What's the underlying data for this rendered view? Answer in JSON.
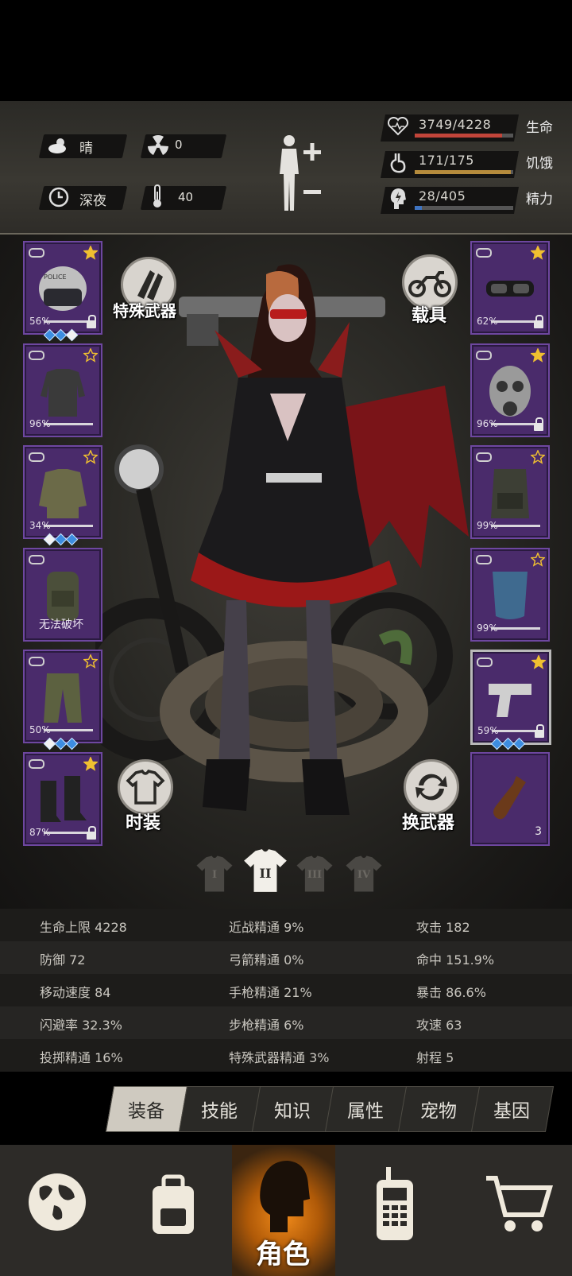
{
  "status": {
    "weather": "晴",
    "radiation": "0",
    "time_of_day": "深夜",
    "temperature": "40"
  },
  "vitals": [
    {
      "value": "3749/4228",
      "label": "生命",
      "fraction": 0.887,
      "color": "#c2453a"
    },
    {
      "value": "171/175",
      "label": "饥饿",
      "fraction": 0.977,
      "color": "#b58b3c"
    },
    {
      "value": "28/405",
      "label": "精力",
      "fraction": 0.069,
      "color": "#3f74c0"
    }
  ],
  "scene_buttons": {
    "special_weapon": "特殊武器",
    "vehicle": "载具",
    "fashion": "时装",
    "swap_weapon": "换武器"
  },
  "left_slots": [
    {
      "name": "helmet",
      "pct": "56%",
      "star": "filled",
      "locked": true,
      "gems": [
        "blue",
        "blue",
        "white"
      ]
    },
    {
      "name": "shirt",
      "pct": "96%",
      "star": "outline",
      "locked": false,
      "gems": []
    },
    {
      "name": "jacket",
      "pct": "34%",
      "star": "outline",
      "locked": false,
      "gems": [
        "white",
        "blue",
        "blue"
      ]
    },
    {
      "name": "backpack",
      "pct": "",
      "text": "无法破坏",
      "star": "none",
      "locked": false,
      "gems": []
    },
    {
      "name": "pants",
      "pct": "50%",
      "star": "outline",
      "locked": false,
      "gems": [
        "white",
        "blue",
        "blue"
      ]
    },
    {
      "name": "boots",
      "pct": "87%",
      "star": "filled",
      "locked": true,
      "gems": []
    }
  ],
  "right_slots": [
    {
      "name": "goggles",
      "pct": "62%",
      "star": "filled",
      "locked": true
    },
    {
      "name": "gas-mask",
      "pct": "96%",
      "star": "filled",
      "locked": true
    },
    {
      "name": "vest",
      "pct": "99%",
      "star": "outline",
      "locked": false
    },
    {
      "name": "shield",
      "pct": "99%",
      "star": "outline",
      "locked": false
    },
    {
      "name": "pistol",
      "pct": "59%",
      "star": "filled",
      "locked": true
    },
    {
      "name": "molotov",
      "count": "3"
    }
  ],
  "outfit_tabs": [
    "I",
    "II",
    "III",
    "IV"
  ],
  "outfit_active": 1,
  "stats": [
    [
      "生命上限 4228",
      "近战精通 9%",
      "攻击 182"
    ],
    [
      "防御 72",
      "弓箭精通 0%",
      "命中 151.9%"
    ],
    [
      "移动速度 84",
      "手枪精通 21%",
      "暴击 86.6%"
    ],
    [
      "闪避率 32.3%",
      "步枪精通 6%",
      "攻速 63"
    ],
    [
      "投掷精通 16%",
      "特殊武器精通 3%",
      "射程 5"
    ]
  ],
  "tabs": [
    "装备",
    "技能",
    "知识",
    "属性",
    "宠物",
    "基因"
  ],
  "active_tab": 0,
  "nav": {
    "character_label": "角色"
  }
}
